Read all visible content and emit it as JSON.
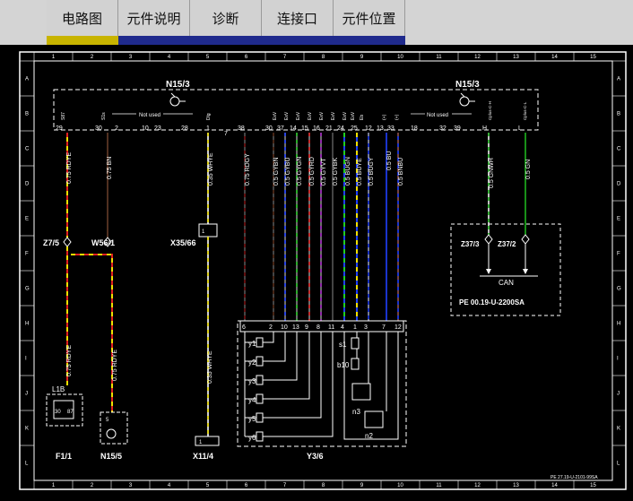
{
  "tabs": [
    {
      "label": "电路图",
      "active": true
    },
    {
      "label": "元件说明",
      "active": false
    },
    {
      "label": "诊断",
      "active": false
    },
    {
      "label": "连接口",
      "active": false
    },
    {
      "label": "元件位置",
      "active": false
    }
  ],
  "grid": {
    "cols": [
      "1",
      "2",
      "3",
      "4",
      "5",
      "6",
      "7",
      "8",
      "9",
      "10",
      "11",
      "12",
      "13",
      "14",
      "15"
    ],
    "rows": [
      "A",
      "B",
      "C",
      "D",
      "E",
      "F",
      "G",
      "H",
      "I",
      "J",
      "K",
      "L"
    ]
  },
  "module": {
    "name_left": "N15/3",
    "name_right": "N15/3",
    "not_used_left": "Not used",
    "not_used_right": "Not used",
    "pin_labels": {
      "p29": "29",
      "p30": "30",
      "p2": "2",
      "p10": "10",
      "p23": "23",
      "p28": "28",
      "p1": "1",
      "p7": "7",
      "p38": "38",
      "p30b": "30",
      "p37": "37",
      "p14": "14",
      "p15": "15",
      "p16": "16",
      "p21": "21",
      "p24": "24",
      "p25": "25",
      "p12": "12",
      "p13": "13",
      "p33": "33",
      "p18": "18",
      "p32": "32",
      "p39": "39",
      "pH": "H",
      "pL": "L"
    },
    "pin_names": [
      "S87",
      "S1s",
      "Dlg",
      "ExV",
      "ExV",
      "ExV",
      "ExV",
      "ExV",
      "ExV",
      "ExV",
      "ExV",
      "Eb",
      "(+)",
      "(+)",
      "Cplus-C-H",
      "Cplus-C-L"
    ]
  },
  "wires": {
    "w1": "0.75 RDYE",
    "w2": "0.75 BN",
    "w3": "0.35 WHYE",
    "w4": "0.75 RDGY",
    "w5": "0.5 GYBN",
    "w6": "0.5 GYBU",
    "w7": "0.5 GYGN",
    "w8": "0.5 GYRD",
    "w9": "0.5 GYVT",
    "w10": "0.5 GYBK",
    "w11": "0.5 BUGN",
    "w12": "0.5 BUYE",
    "w13": "0.5 BUGY",
    "w14": "0.5 BU",
    "w15": "0.5 BNBU",
    "w16": "0.5 GNWH",
    "w17": "0.5 GN",
    "w18": "0.75 RDYE",
    "w19": "0.75 RDYE",
    "w20": "0.35 WHYE"
  },
  "components": {
    "z7": "Z7/5",
    "w56": "W56/1",
    "x35": "X35/66",
    "x35pin": "1",
    "z37a": "Z37/3",
    "z37b": "Z37/2",
    "can": "CAN",
    "pe_ref": "PE 00.19-U-2200SA",
    "l1b": "L1B",
    "l1b_a": "30",
    "l1b_b": "87",
    "f1": "F1/1",
    "n15_5": "N15/5",
    "n15_5pin": "5",
    "x11": "X11/4",
    "x11pin": "1",
    "y3": "Y3/6",
    "y3pins": [
      "6",
      "2",
      "10",
      "13",
      "9",
      "8",
      "11",
      "4",
      "1",
      "3",
      "7",
      "12"
    ],
    "valves": [
      "y1",
      "y2",
      "y3",
      "y4",
      "y5",
      "y6"
    ],
    "s1": "s1",
    "b10": "b10",
    "n3": "n3",
    "n2": "n2"
  },
  "footer_ref": "PE 27.19-U-2101-99SA"
}
